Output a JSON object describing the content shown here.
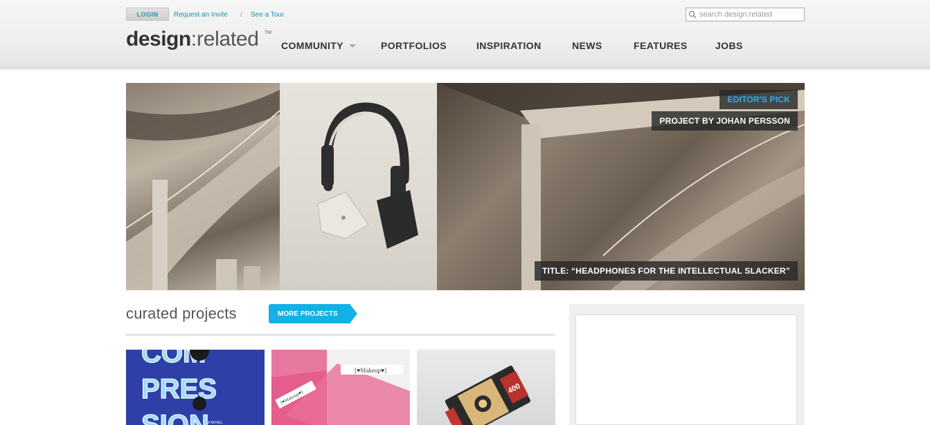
{
  "header": {
    "login_label": "LOGIN",
    "request_invite": "Request an Invite",
    "separator": "/",
    "see_tour": "See a Tour",
    "search_placeholder": "search design:related",
    "logo_part1": "design",
    "logo_colon": ":",
    "logo_part2": "related",
    "logo_tm": "TM"
  },
  "nav": {
    "community": "COMMUNITY",
    "portfolios": "PORTFOLIOS",
    "inspiration": "INSPIRATION",
    "news": "NEWS",
    "features": "FEATURES",
    "jobs": "JOBS"
  },
  "hero": {
    "editors_pick": "EDITOR'S PICK",
    "author": "PROJECT BY JOHAN PERSSON",
    "title": "TITLE: “HEADPHONES FOR THE INTELLECTUAL SLACKER”"
  },
  "curated": {
    "title": "curated projects",
    "more_button": "MORE PROJECTS"
  },
  "thumbs": {
    "t1_text": "COM PRES SION",
    "t1_sub": "A NOVEL",
    "t2_label": "[♥Makeup♥]",
    "t3_badge": "400"
  },
  "colors": {
    "accent": "#12b1e6",
    "link": "#1a8db4",
    "nav_text": "#333333"
  }
}
